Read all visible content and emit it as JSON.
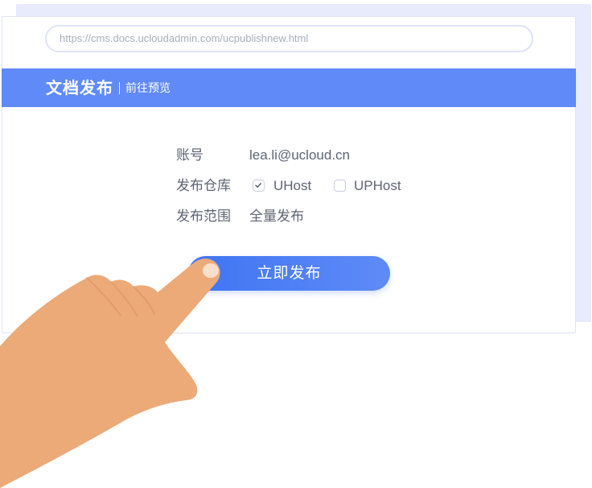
{
  "browser": {
    "url": "https://cms.docs.ucloudadmin.com/ucpublishnew.html"
  },
  "header": {
    "title": "文档发布",
    "preview_link": "前往预览",
    "bar_color": "#5f8af8"
  },
  "form": {
    "account": {
      "label": "账号",
      "value": "lea.li@ucloud.cn"
    },
    "repository": {
      "label": "发布仓库",
      "options": [
        {
          "label": "UHost",
          "checked": true
        },
        {
          "label": "UPHost",
          "checked": false
        }
      ]
    },
    "scope": {
      "label": "发布范围",
      "value": "全量发布"
    }
  },
  "actions": {
    "publish_label": "立即发布",
    "publish_color": "#4a7cf5"
  },
  "decor": {
    "hand_icon": "pointing-hand-icon",
    "hand_color": "#ecaa78"
  }
}
